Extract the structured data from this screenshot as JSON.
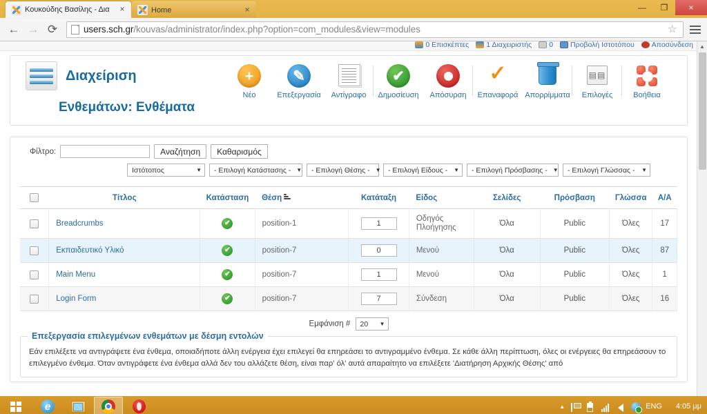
{
  "browser": {
    "tabs": [
      {
        "title": "Κουκούδης Βασίλης - Δια",
        "favicon": "joomla-icon",
        "active": true,
        "close_label": "×"
      },
      {
        "title": "Home",
        "favicon": "joomla-icon",
        "active": false,
        "close_label": "×"
      }
    ],
    "window_controls": {
      "minimize": "—",
      "maximize": "❐",
      "close": "×"
    },
    "nav": {
      "back": "←",
      "forward": "→",
      "reload": "⟳"
    },
    "url": {
      "domain": "users.sch.gr",
      "path": "/kouvas/administrator/index.php?option=com_modules&view=modules",
      "full": "users.sch.gr/kouvas/administrator/index.php?option=com_modules&view=modules"
    },
    "star_glyph": "☆",
    "menu_label": "chrome-menu"
  },
  "status_strip": {
    "items": [
      {
        "icon": "visitors-icon",
        "label": "0 Επισκέπτες"
      },
      {
        "icon": "admins-icon",
        "label": "1 Διαχειριστής"
      },
      {
        "icon": "mail-icon",
        "label": "0"
      },
      {
        "icon": "preview-icon",
        "label": "Προβολή Ιστοτόπου"
      },
      {
        "icon": "logout-icon",
        "label": "Αποσύνδεση"
      }
    ]
  },
  "header": {
    "brand": "Διαχείριση",
    "subtitle": "Ενθεμάτων: Ενθέματα",
    "logo_name": "joomla-logo"
  },
  "toolbar": {
    "items": [
      {
        "label": "Νέο",
        "icon": "new-icon",
        "sep": false
      },
      {
        "label": "Επεξεργασία",
        "icon": "edit-icon",
        "sep": false
      },
      {
        "label": "Αντίγραφο",
        "icon": "copy-icon",
        "sep": false
      },
      {
        "label": "Δημοσίευση",
        "icon": "publish-icon",
        "sep": true
      },
      {
        "label": "Απόσυρση",
        "icon": "unpublish-icon",
        "sep": false
      },
      {
        "label": "Επαναφορά",
        "icon": "restore-icon",
        "sep": true
      },
      {
        "label": "Απορρίμματα",
        "icon": "trash-icon",
        "sep": false
      },
      {
        "label": "Επιλογές",
        "icon": "options-icon",
        "sep": true
      },
      {
        "label": "Βοήθεια",
        "icon": "help-icon",
        "sep": true
      }
    ]
  },
  "filters": {
    "filter_label": "Φίλτρο:",
    "filter_value": "",
    "filter_placeholder": "",
    "search_button": "Αναζήτηση",
    "clear_button": "Καθαρισμός",
    "selects": [
      {
        "name": "site-select",
        "value": "Ιστότοπος",
        "width": "w-site"
      },
      {
        "name": "status-select",
        "value": "- Επιλογή Κατάστασης -",
        "width": "w-status"
      },
      {
        "name": "position-select",
        "value": "- Επιλογή Θέσης -",
        "width": "w-position"
      },
      {
        "name": "type-select",
        "value": "- Επιλογή Είδους -",
        "width": "w-type"
      },
      {
        "name": "access-select",
        "value": "- Επιλογή Πρόσβασης -",
        "width": "w-access"
      },
      {
        "name": "language-select",
        "value": "- Επιλογή Γλώσσας -",
        "width": "w-lang"
      }
    ],
    "caret": "▼"
  },
  "table": {
    "columns": [
      {
        "key": "check",
        "label": "",
        "align": "center"
      },
      {
        "key": "title",
        "label": "Τίτλος",
        "align": "center"
      },
      {
        "key": "status",
        "label": "Κατάσταση",
        "align": "center"
      },
      {
        "key": "position",
        "label": "Θέση",
        "align": "left",
        "sorted": true
      },
      {
        "key": "ordering",
        "label": "Κατάταξη",
        "align": "center"
      },
      {
        "key": "type",
        "label": "Είδος",
        "align": "left"
      },
      {
        "key": "pages",
        "label": "Σελίδες",
        "align": "center"
      },
      {
        "key": "access",
        "label": "Πρόσβαση",
        "align": "center"
      },
      {
        "key": "language",
        "label": "Γλώσσα",
        "align": "center"
      },
      {
        "key": "id",
        "label": "A/A",
        "align": "center"
      }
    ],
    "rows": [
      {
        "title": "Breadcrumbs",
        "status": "published",
        "position": "position-1",
        "ordering": "1",
        "type": "Οδηγός Πλοήγησης",
        "pages": "Όλα",
        "access": "Public",
        "language": "Όλες",
        "id": "17",
        "style": "plain"
      },
      {
        "title": "Εκπαιδευτικό Υλικό",
        "status": "published",
        "position": "position-7",
        "ordering": "0",
        "type": "Μενού",
        "pages": "Όλα",
        "access": "Public",
        "language": "Όλες",
        "id": "87",
        "style": "hl"
      },
      {
        "title": "Main Menu",
        "status": "published",
        "position": "position-7",
        "ordering": "1",
        "type": "Μενού",
        "pages": "Όλα",
        "access": "Public",
        "language": "Όλες",
        "id": "1",
        "style": "plain"
      },
      {
        "title": "Login Form",
        "status": "published",
        "position": "position-7",
        "ordering": "7",
        "type": "Σύνδεση",
        "pages": "Όλα",
        "access": "Public",
        "language": "Όλες",
        "id": "16",
        "style": "alt"
      }
    ],
    "status_glyph": "✔"
  },
  "display": {
    "label": "Εμφάνιση #",
    "value": "20",
    "caret": "▼"
  },
  "batch": {
    "legend": "Επεξεργασία επιλεγμένων ενθεμάτων με δέσμη εντολών",
    "text": "Εάν επιλέξετε να αντιγράψετε ένα ένθεμα, οποιαδήποτε άλλη ενέργεια έχει επιλεγεί θα επηρεάσει το αντιγραμμένο ένθεμα. Σε κάθε άλλη περίπτωση, όλες οι ενέργειες θα επηρεάσουν το επιλεγμένο ένθεμα. Όταν αντιγράφετε ένα ένθεμα αλλά δεν του αλλάζετε θέση, είναι παρ' όλ' αυτά απαραίτητο να επιλέξετε 'Διατήρηση Αρχικής Θέσης' από"
  },
  "taskbar": {
    "start_label": "start-button",
    "apps": [
      {
        "name": "internet-explorer",
        "active": false
      },
      {
        "name": "file-explorer",
        "active": false
      },
      {
        "name": "google-chrome",
        "active": true
      },
      {
        "name": "opera",
        "active": false
      }
    ],
    "tray": {
      "arrow": "▲",
      "icons": [
        "action-center-flag-icon",
        "battery-icon",
        "signal-icon",
        "speaker-icon",
        "network-icon"
      ],
      "language": "ENG",
      "clock": "4:05 μμ"
    }
  },
  "colors": {
    "chrome_frame": "#e0ab3c",
    "accent_blue": "#2b6ca3",
    "brand_blue": "#176ba0",
    "published_green": "#1e9127",
    "unpublish_red": "#c41616",
    "row_highlight": "#e8f4fc",
    "taskbar": "#d99b2a"
  }
}
